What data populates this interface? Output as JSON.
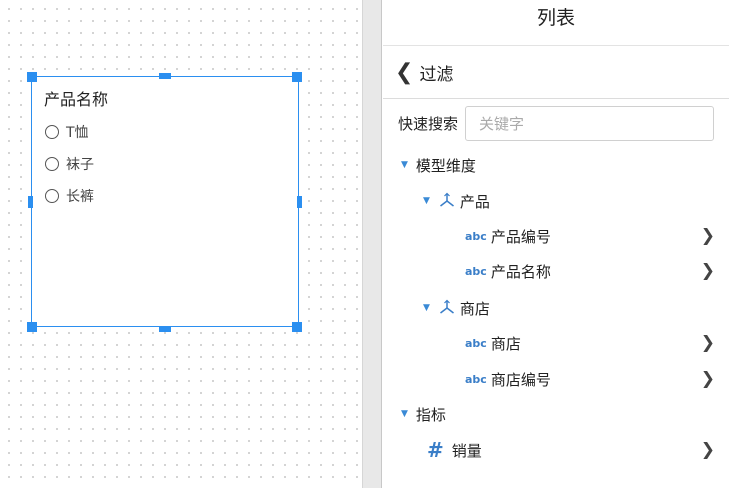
{
  "widget": {
    "title": "产品名称",
    "options": [
      "T恤",
      "袜子",
      "长裤"
    ]
  },
  "panel": {
    "title": "列表",
    "filter_label": "过滤",
    "search": {
      "label": "快速搜索",
      "placeholder": "关键字"
    },
    "tree": {
      "model_dims": "模型维度",
      "product_group": "产品",
      "product_code": "产品编号",
      "product_name": "产品名称",
      "store_group": "商店",
      "store": "商店",
      "store_code": "商店编号",
      "metrics": "指标",
      "sales": "销量",
      "abc_tag": "abc",
      "hash_tag": "#"
    }
  },
  "colors": {
    "accent": "#2b8ff0",
    "field_icon": "#3a7ec8"
  }
}
